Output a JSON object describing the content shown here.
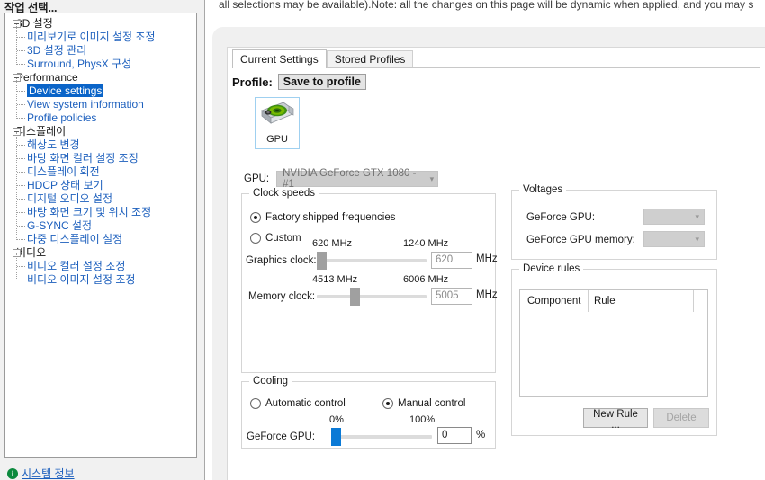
{
  "sidebar": {
    "header": "작업 선택...",
    "system_info_label": "시스템 정보",
    "system_info_icon": "info-circle-icon",
    "tree": [
      {
        "label": "3D 설정",
        "type": "root",
        "selected": false
      },
      {
        "label": "미리보기로 이미지 설정 조정",
        "type": "child",
        "selected": false
      },
      {
        "label": "3D 설정 관리",
        "type": "child",
        "selected": false
      },
      {
        "label": "Surround, PhysX 구성",
        "type": "child",
        "selected": false
      },
      {
        "label": "Performance",
        "type": "root",
        "selected": false
      },
      {
        "label": "Device settings",
        "type": "child",
        "selected": true
      },
      {
        "label": "View system information",
        "type": "child",
        "selected": false
      },
      {
        "label": "Profile policies",
        "type": "child",
        "selected": false
      },
      {
        "label": "디스플레이",
        "type": "root",
        "selected": false
      },
      {
        "label": "해상도 변경",
        "type": "child",
        "selected": false
      },
      {
        "label": "바탕 화면 컬러 설정 조정",
        "type": "child",
        "selected": false
      },
      {
        "label": "디스플레이 회전",
        "type": "child",
        "selected": false
      },
      {
        "label": "HDCP 상태 보기",
        "type": "child",
        "selected": false
      },
      {
        "label": "디지털 오디오 설정",
        "type": "child",
        "selected": false
      },
      {
        "label": "바탕 화면 크기 및 위치 조정",
        "type": "child",
        "selected": false
      },
      {
        "label": "G-SYNC 설정",
        "type": "child",
        "selected": false
      },
      {
        "label": "다중 디스플레이 설정",
        "type": "child",
        "selected": false
      },
      {
        "label": "비디오",
        "type": "root",
        "selected": false
      },
      {
        "label": "비디오 컬러 설정 조정",
        "type": "child",
        "selected": false
      },
      {
        "label": "비디오 이미지 설정 조정",
        "type": "child",
        "selected": false
      }
    ]
  },
  "top_note": "all selections may be available).Note: all the changes on this page will be dynamic when applied, and you may s",
  "tabs": [
    {
      "label": "Current Settings",
      "active": true
    },
    {
      "label": "Stored Profiles",
      "active": false
    }
  ],
  "profile": {
    "label": "Profile:",
    "save_button": "Save to profile"
  },
  "gpu_tile": {
    "caption": "GPU",
    "icon": "nvidia-graphics-card-icon"
  },
  "gpu_select": {
    "label": "GPU:",
    "value": "NVIDIA GeForce GTX 1080 - #1",
    "enabled": false,
    "chevron": "▾"
  },
  "clock_speeds": {
    "title": "Clock speeds",
    "option_factory": "Factory shipped frequencies",
    "option_custom": "Custom",
    "selected_option": "factory",
    "graphics_clock": {
      "label": "Graphics clock:",
      "min_label": "620 MHz",
      "max_label": "1240 MHz",
      "value": "620",
      "unit": "MHz",
      "min": 620,
      "max": 1240,
      "thumb_percent": 0
    },
    "memory_clock": {
      "label": "Memory clock:",
      "min_label": "4513 MHz",
      "max_label": "6006 MHz",
      "value": "5005",
      "unit": "MHz",
      "min": 4513,
      "max": 6006,
      "thumb_percent": 33
    }
  },
  "cooling": {
    "title": "Cooling",
    "option_automatic": "Automatic control",
    "option_manual": "Manual control",
    "selected_option": "manual",
    "fan": {
      "label": "GeForce GPU:",
      "min_label": "0%",
      "max_label": "100%",
      "value": "0",
      "unit": "%",
      "thumb_percent": 0
    }
  },
  "voltages": {
    "title": "Voltages",
    "gpu_label": "GeForce GPU:",
    "gpu_value": "",
    "memory_label": "GeForce GPU memory:",
    "memory_value": "",
    "enabled": false,
    "chevron": "▾"
  },
  "device_rules": {
    "title": "Device rules",
    "columns": [
      "Component",
      "Rule"
    ],
    "rows": [],
    "new_rule_button": "New Rule ...",
    "delete_button": "Delete",
    "delete_enabled": false
  },
  "colors": {
    "selection_blue": "#0a64c8",
    "link_blue": "#1c5fbd",
    "slider_blue": "#0b7ad6",
    "nvidia_green": "#76b900",
    "panel_grey": "#f0f0f0",
    "sidebar_grey": "#f1f1f1"
  }
}
